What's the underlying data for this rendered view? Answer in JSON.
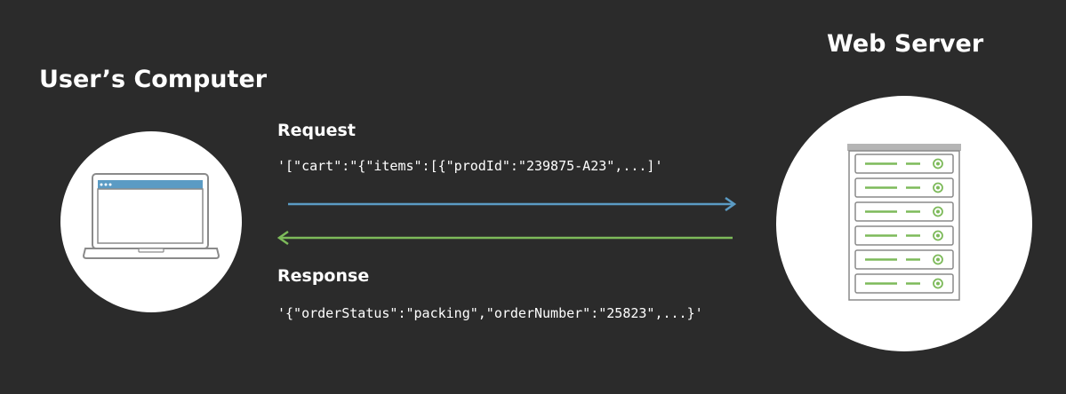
{
  "user_computer": {
    "title": "User’s Computer",
    "icon": "laptop-icon"
  },
  "web_server": {
    "title": "Web Server",
    "icon": "server-rack-icon"
  },
  "request": {
    "label": "Request",
    "payload": "'[\"cart\":\"{\"items\":[{\"prodId\":\"239875-A23\",...]'",
    "arrow_color": "#5b9bc4",
    "direction": "user-to-server"
  },
  "response": {
    "label": "Response",
    "payload": "'{\"orderStatus\":\"packing\",\"orderNumber\":\"25823\",...}'",
    "arrow_color": "#7dba5a",
    "direction": "server-to-user"
  },
  "colors": {
    "background": "#2b2b2b",
    "text": "#ffffff",
    "circle": "#ffffff",
    "laptop_screen_header": "#5b9bc4",
    "server_indicator": "#7dba5a"
  }
}
